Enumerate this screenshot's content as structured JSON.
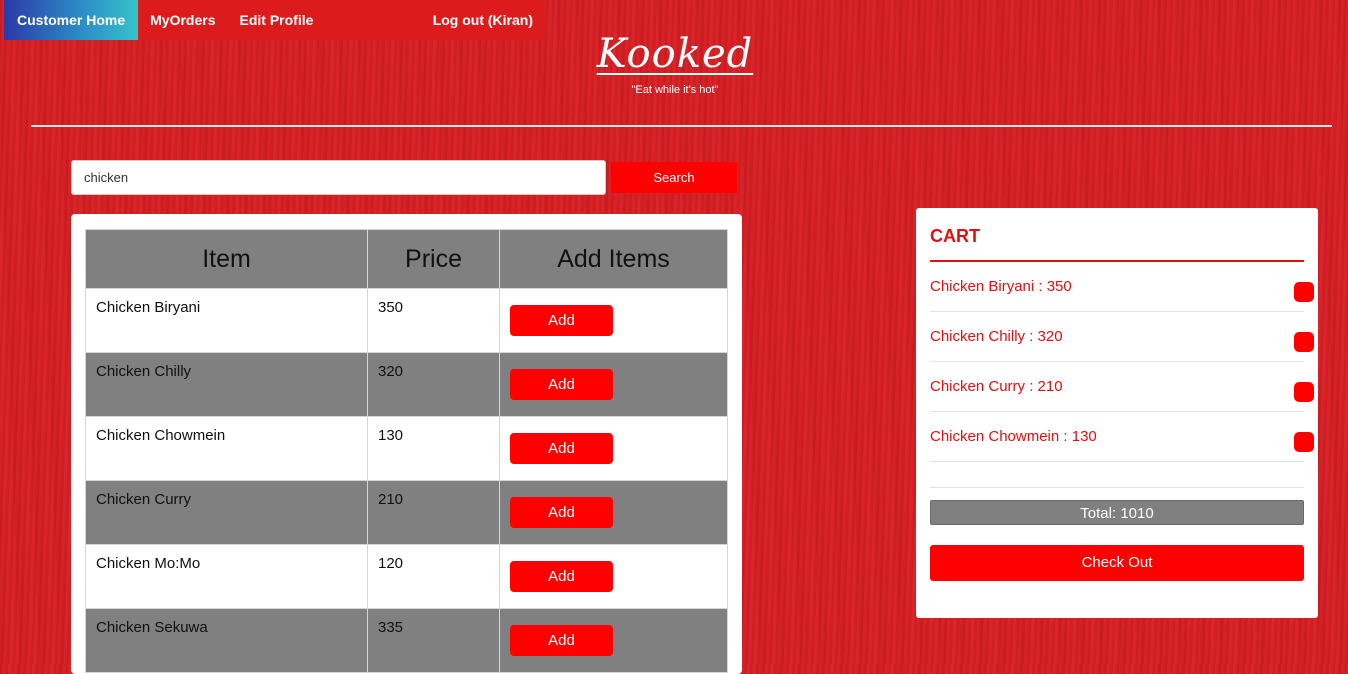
{
  "nav": {
    "items": [
      {
        "label": "Customer Home",
        "active": true
      },
      {
        "label": "MyOrders"
      },
      {
        "label": "Edit Profile"
      }
    ],
    "logout_label": "Log out (Kiran)"
  },
  "brand": {
    "name": "Kooked",
    "tagline": "\"Eat while it's hot\""
  },
  "search": {
    "value": "chicken",
    "button_label": "Search"
  },
  "menu": {
    "headers": [
      "Item",
      "Price",
      "Add Items"
    ],
    "add_label": "Add",
    "rows": [
      {
        "item": "Chicken Biryani",
        "price": "350"
      },
      {
        "item": "Chicken Chilly",
        "price": "320"
      },
      {
        "item": "Chicken Chowmein",
        "price": "130"
      },
      {
        "item": "Chicken Curry",
        "price": "210"
      },
      {
        "item": "Chicken Mo:Mo",
        "price": "120"
      },
      {
        "item": "Chicken Sekuwa",
        "price": "335"
      }
    ]
  },
  "cart": {
    "title": "CART",
    "items": [
      {
        "label": "Chicken Biryani : 350"
      },
      {
        "label": "Chicken Chilly : 320"
      },
      {
        "label": "Chicken Curry : 210"
      },
      {
        "label": "Chicken Chowmein : 130"
      }
    ],
    "total": "Total: 1010",
    "checkout_label": "Check Out"
  },
  "colors": {
    "background": "#d71f24",
    "accent": "#ff0000",
    "row_alt": "#808080"
  }
}
